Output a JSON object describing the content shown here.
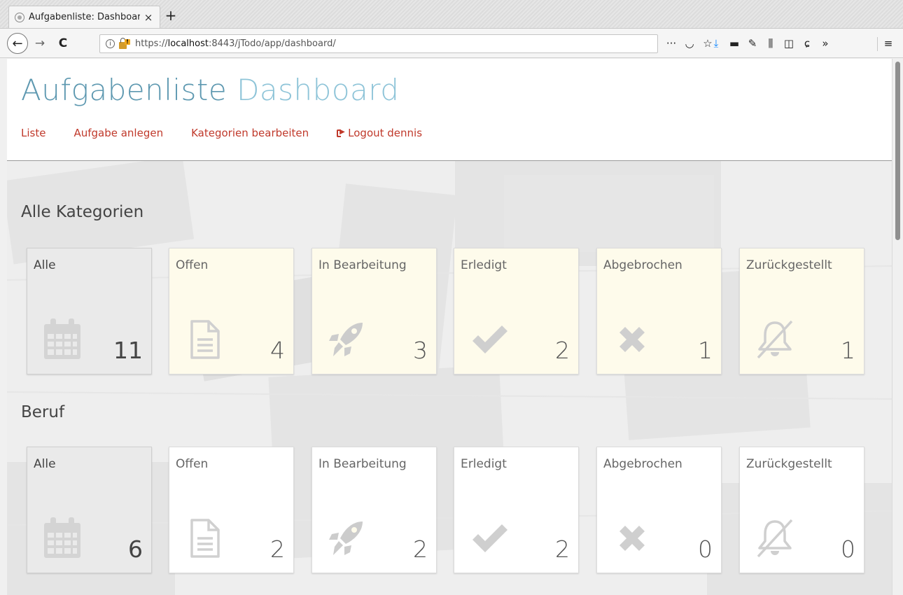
{
  "browser": {
    "tab_title": "Aufgabenliste: Dashboar",
    "tab_close": "×",
    "new_tab": "+",
    "back": "←",
    "forward": "→",
    "reload": "C",
    "info_glyph": "i",
    "url_prefix": "https://",
    "url_host": "localhost",
    "url_rest": ":8443/jTodo/app/dashboard/",
    "toolbar_icons": [
      {
        "name": "page-actions-icon",
        "glyph": "···"
      },
      {
        "name": "pocket-icon",
        "glyph": "◡"
      },
      {
        "name": "bookmark-star-icon",
        "glyph": "☆"
      },
      {
        "name": "downloads-icon",
        "glyph": "⤓"
      },
      {
        "name": "extension-icon",
        "glyph": "▬"
      },
      {
        "name": "wrench-icon",
        "glyph": "✎"
      },
      {
        "name": "library-icon",
        "glyph": "⫼"
      },
      {
        "name": "sidebar-icon",
        "glyph": "◫"
      },
      {
        "name": "gnome-extension-icon",
        "glyph": "ɕ"
      },
      {
        "name": "overflow-icon",
        "glyph": "»"
      },
      {
        "name": "hamburger-menu-icon",
        "glyph": "≡"
      }
    ]
  },
  "header": {
    "title_main": "Aufgabenliste",
    "title_sub": "Dashboard",
    "nav": {
      "list": "Liste",
      "create_task": "Aufgabe anlegen",
      "edit_categories": "Kategorien bearbeiten",
      "logout": "Logout dennis"
    }
  },
  "colors": {
    "title": "#5d98b0",
    "title_sub": "#8ec4d8",
    "link": "#c0392b",
    "tile_yellow": "#fefbeb",
    "tile_gray": "#eaeaea"
  },
  "sections": [
    {
      "title": "Alle Kategorien",
      "tiles": [
        {
          "label": "Alle",
          "count": "11",
          "icon": "calendar-icon"
        },
        {
          "label": "Offen",
          "count": "4",
          "icon": "document-icon"
        },
        {
          "label": "In Bearbeitung",
          "count": "3",
          "icon": "rocket-icon"
        },
        {
          "label": "Erledigt",
          "count": "2",
          "icon": "check-icon"
        },
        {
          "label": "Abgebrochen",
          "count": "1",
          "icon": "x-icon"
        },
        {
          "label": "Zurückgestellt",
          "count": "1",
          "icon": "bell-slash-icon"
        }
      ]
    },
    {
      "title": "Beruf",
      "tiles": [
        {
          "label": "Alle",
          "count": "6",
          "icon": "calendar-icon"
        },
        {
          "label": "Offen",
          "count": "2",
          "icon": "document-icon"
        },
        {
          "label": "In Bearbeitung",
          "count": "2",
          "icon": "rocket-icon"
        },
        {
          "label": "Erledigt",
          "count": "2",
          "icon": "check-icon"
        },
        {
          "label": "Abgebrochen",
          "count": "0",
          "icon": "x-icon"
        },
        {
          "label": "Zurückgestellt",
          "count": "0",
          "icon": "bell-slash-icon"
        }
      ]
    }
  ]
}
